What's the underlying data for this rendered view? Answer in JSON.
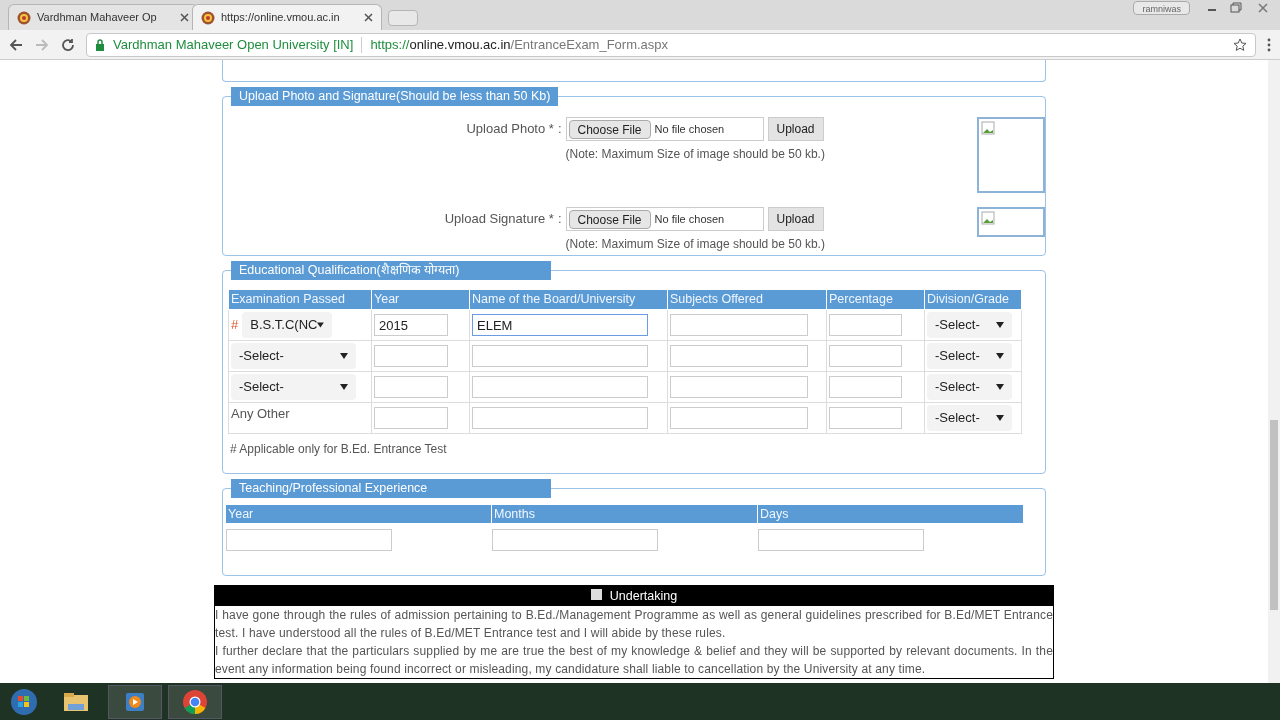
{
  "browser": {
    "tabs": [
      {
        "title": "Vardhman Mahaveer Op",
        "selected": false
      },
      {
        "title": "https://online.vmou.ac.in",
        "selected": true
      }
    ],
    "user": "ramniwas",
    "site_name": "Vardhman Mahaveer Open University [IN]",
    "url_scheme": "https://",
    "url_host": "online.vmou.ac.in",
    "url_path": "/EntranceExam_Form.aspx"
  },
  "upload_section": {
    "legend": "Upload Photo and Signature(Should be less than 50 Kb)",
    "rows": [
      {
        "label": "Upload Photo *",
        "colon": ":",
        "choose": "Choose File",
        "status": "No file chosen",
        "upload": "Upload",
        "note": "(Note: Maximum Size of image should be 50 kb.)",
        "kind": "photo"
      },
      {
        "label": "Upload Signature *",
        "colon": ":",
        "choose": "Choose File",
        "status": "No file chosen",
        "upload": "Upload",
        "note": "(Note: Maximum Size of image should be 50 kb.)",
        "kind": "signature"
      }
    ]
  },
  "education": {
    "legend": "Educational Qualification(शैक्षणिक योग्यता)",
    "columns": [
      "Examination Passed",
      "Year",
      "Name of the Board/University",
      "Subjects Offered",
      "Percentage",
      "Division/Grade"
    ],
    "rows": [
      {
        "kind": "select",
        "marker": "#",
        "exam": "B.S.T.C(NC",
        "year": "2015",
        "board": "ELEM",
        "division": "-Select-"
      },
      {
        "kind": "select",
        "exam": "-Select-",
        "division": "-Select-"
      },
      {
        "kind": "select",
        "exam": "-Select-",
        "division": "-Select-"
      },
      {
        "kind": "text",
        "exam": "Any Other",
        "division": "-Select-"
      }
    ],
    "footnote": "# Applicable only for B.Ed. Entrance Test"
  },
  "experience": {
    "legend": "Teaching/Professional Experience",
    "columns": [
      "Year",
      "Months",
      "Days"
    ]
  },
  "undertaking": {
    "title": "Undertaking",
    "checked": false,
    "paragraphs": [
      "I have gone through the rules of admission pertaining to B.Ed./Management Programme as well as general guidelines prescribed for B.Ed/MET Entrance test. I have understood all the rules of B.Ed/MET Entrance test and I will abide by these rules.",
      "I further declare that the particulars supplied by me are true the best of my knowledge & belief and they will be supported by relevant documents. In the event any information being found incorrect or misleading, my candidature shall liable to cancellation by the University at any time."
    ]
  }
}
